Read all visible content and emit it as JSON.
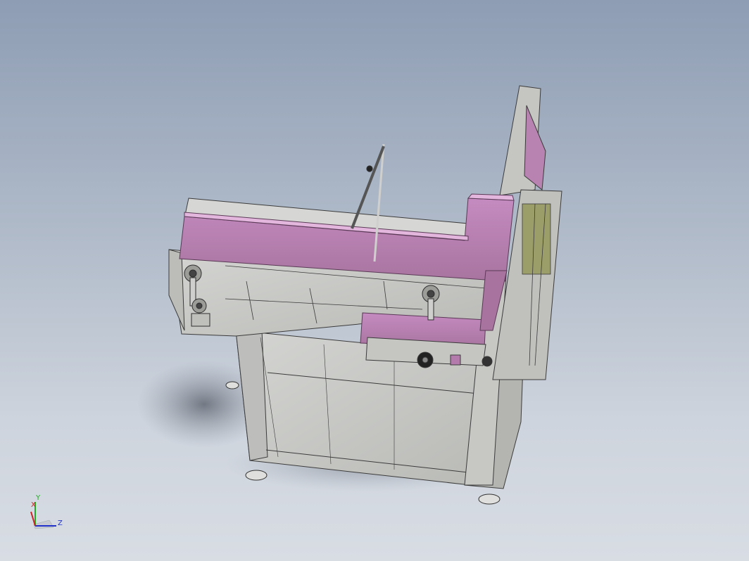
{
  "viewport": {
    "background_top": "#8e9db4",
    "background_bottom": "#d8dde4"
  },
  "model": {
    "frame_color": "#c9cac7",
    "guard_color": "#b07aa8",
    "edge_color": "#3b3b3b",
    "shadow_color": "#6d7380"
  },
  "triad": {
    "x_label": "X",
    "y_label": "Y",
    "z_label": "Z",
    "x_color": "#cc2222",
    "y_color": "#22aa22",
    "z_color": "#2233cc"
  }
}
